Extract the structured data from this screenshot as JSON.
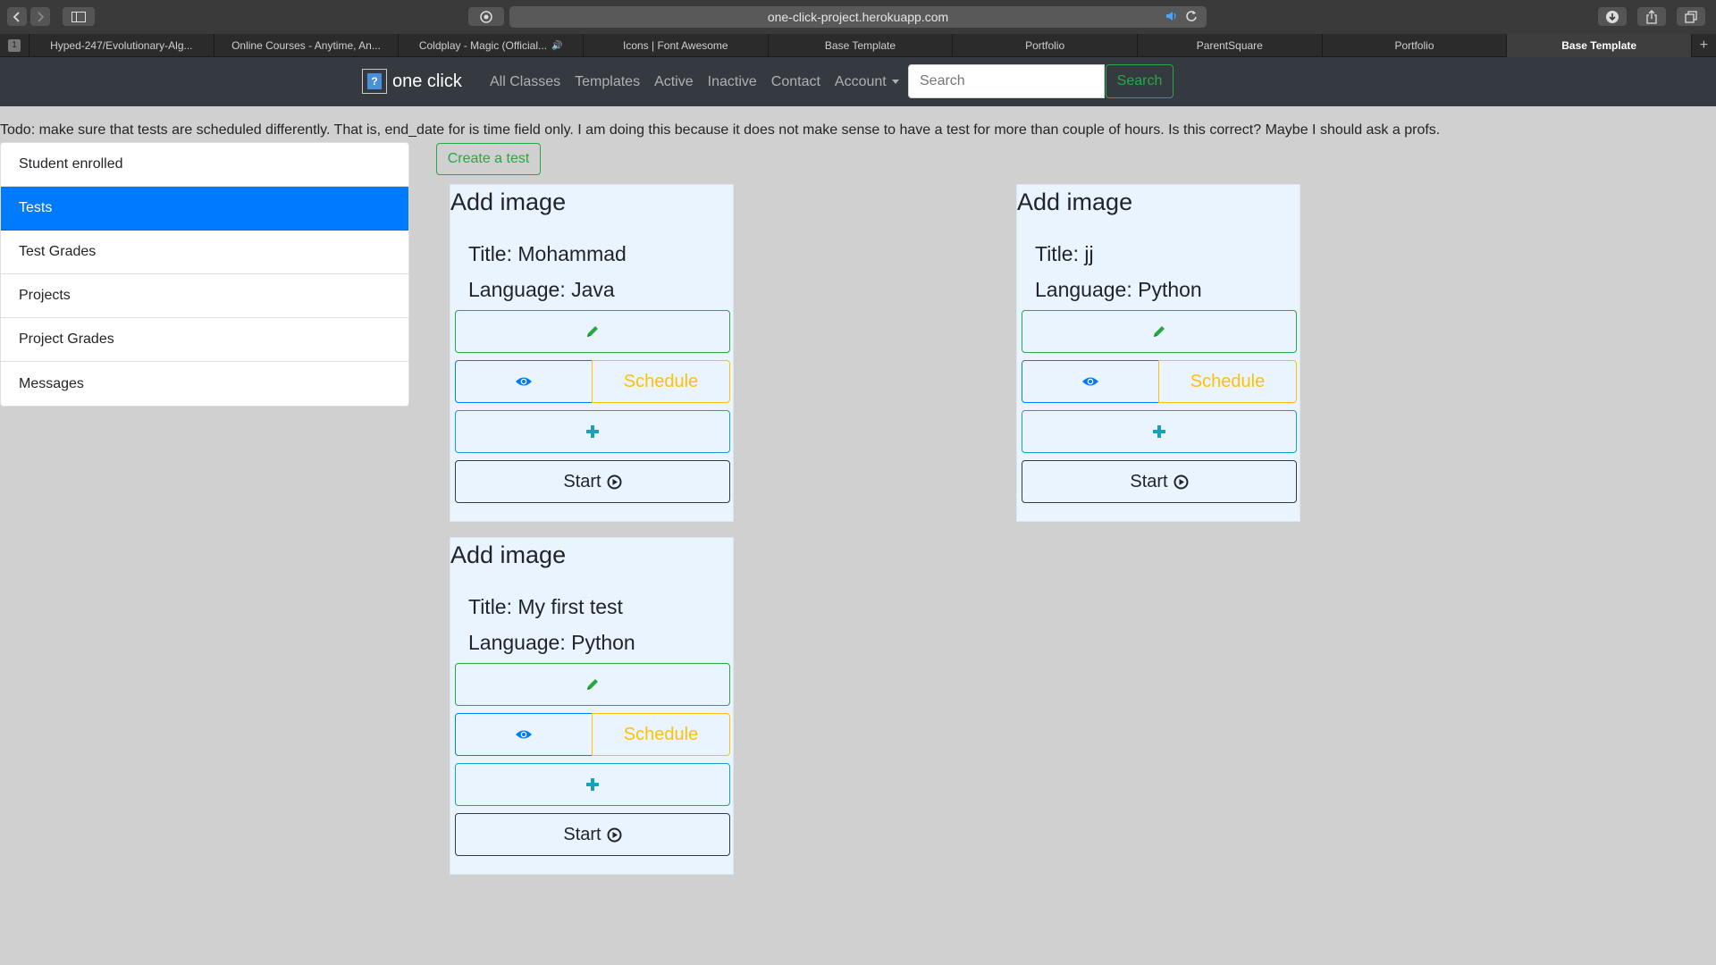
{
  "browser": {
    "url": "one-click-project.herokuapp.com",
    "tab_count_badge": "1",
    "tabs": [
      {
        "label": "Hyped-247/Evolutionary-Alg...",
        "active": false
      },
      {
        "label": "Online Courses - Anytime, An...",
        "active": false
      },
      {
        "label": "Coldplay - Magic (Official...",
        "active": false
      },
      {
        "label": "Icons | Font Awesome",
        "active": false
      },
      {
        "label": "Base Template",
        "active": false
      },
      {
        "label": "Portfolio",
        "active": false
      },
      {
        "label": "ParentSquare",
        "active": false
      },
      {
        "label": "Portfolio",
        "active": false
      },
      {
        "label": "Base Template",
        "active": true
      }
    ]
  },
  "navbar": {
    "brand": "one click",
    "links": [
      "All Classes",
      "Templates",
      "Active",
      "Inactive",
      "Contact"
    ],
    "account": "Account",
    "search_placeholder": "Search",
    "search_button": "Search"
  },
  "todo": "Todo: make sure that tests are scheduled differently. That is, end_date for is time field only. I am doing this because it does not make sense to have a test for more than couple of hours. Is this correct? Maybe I should ask a profs.",
  "sidebar": {
    "items": [
      {
        "label": "Student enrolled",
        "active": false
      },
      {
        "label": "Tests",
        "active": true
      },
      {
        "label": "Test Grades",
        "active": false
      },
      {
        "label": "Projects",
        "active": false
      },
      {
        "label": "Project Grades",
        "active": false
      },
      {
        "label": "Messages",
        "active": false
      }
    ]
  },
  "create_button": "Create a test",
  "cards": [
    {
      "heading": "Add image",
      "title": "Title: Mohammad",
      "language": "Language: Java",
      "schedule": "Schedule",
      "start": "Start"
    },
    {
      "heading": "Add image",
      "title": "Title: jj",
      "language": "Language: Python",
      "schedule": "Schedule",
      "start": "Start"
    },
    {
      "heading": "Add image",
      "title": "Title: My first test",
      "language": "Language: Python",
      "schedule": "Schedule",
      "start": "Start"
    }
  ],
  "colors": {
    "navbar": "#343a40",
    "primary": "#007bff",
    "success": "#28a745",
    "warning": "#ffc107",
    "info": "#17a2b8",
    "card_bg": "#eaf4ff",
    "page_bg": "#d0d0d0"
  },
  "icons": {
    "edit": "pencil-icon",
    "view": "eye-icon",
    "add": "plus-icon",
    "start": "play-circle-icon"
  }
}
